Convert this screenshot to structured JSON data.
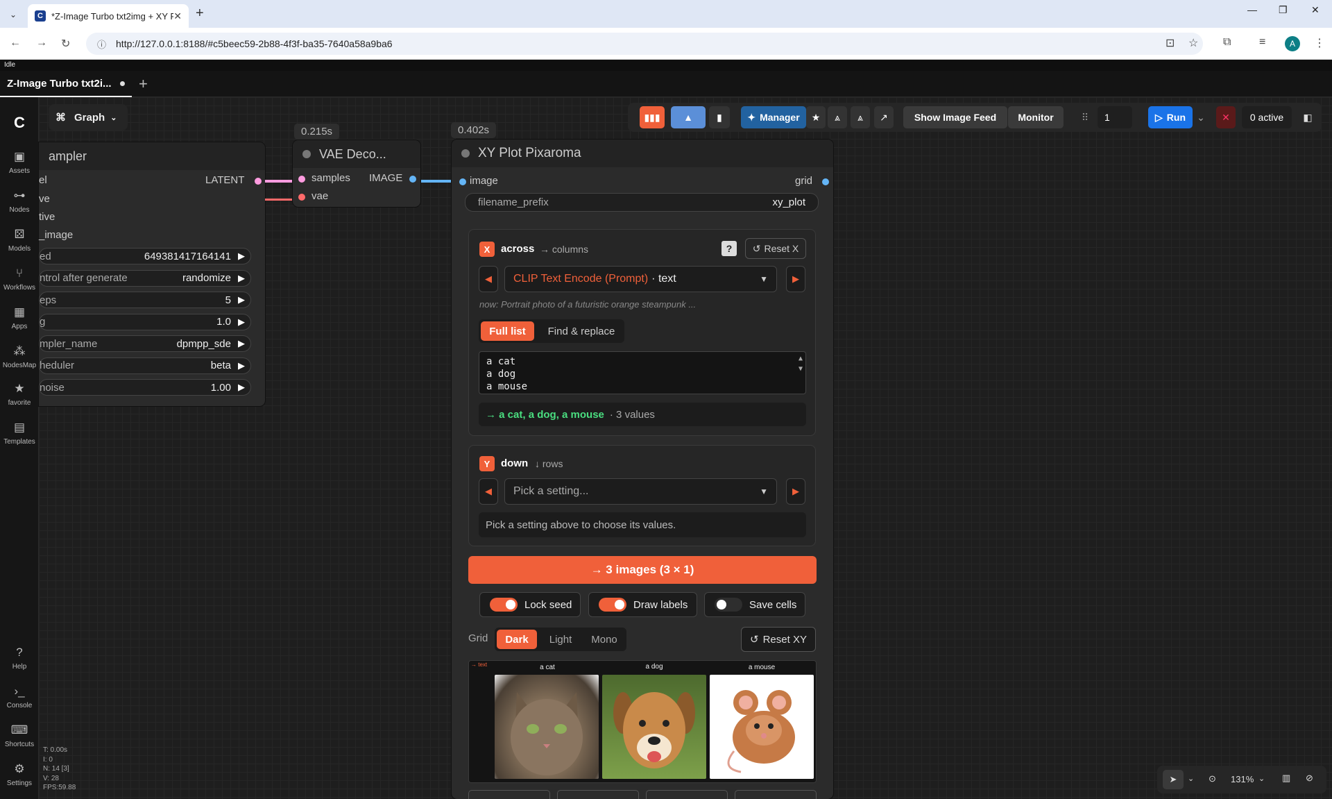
{
  "browser": {
    "tab_title": "*Z-Image Turbo txt2img + XY P",
    "url": "http://127.0.0.1:8188/#c5beec59-2b88-4f3f-ba35-7640a58a9ba6",
    "avatar": "A"
  },
  "status": "Idle",
  "workspace": {
    "tab": "Z-Image Turbo txt2i...",
    "view_button": "Graph"
  },
  "sidebar": [
    {
      "label": "Assets",
      "icon": "image-icon"
    },
    {
      "label": "Nodes",
      "icon": "node-icon"
    },
    {
      "label": "Models",
      "icon": "cube-icon"
    },
    {
      "label": "Workflows",
      "icon": "workflow-icon"
    },
    {
      "label": "Apps",
      "icon": "apps-icon"
    },
    {
      "label": "NodesMap",
      "icon": "map-icon"
    },
    {
      "label": "favorite",
      "icon": "star-icon"
    },
    {
      "label": "Templates",
      "icon": "template-icon"
    },
    {
      "label": "Help",
      "icon": "help-icon"
    },
    {
      "label": "Console",
      "icon": "terminal-icon"
    },
    {
      "label": "Shortcuts",
      "icon": "keyboard-icon"
    },
    {
      "label": "Settings",
      "icon": "gear-icon"
    }
  ],
  "toolbar": {
    "manager": "Manager",
    "show_image_feed": "Show Image Feed",
    "monitor": "Monitor",
    "batch_count": "1",
    "run": "Run",
    "active": "0 active",
    "accent": "#f0603a",
    "run_color": "#1a73e8"
  },
  "ksampler": {
    "title": "ampler",
    "latent": "LATENT",
    "inputs": [
      "el",
      "ve",
      "tive",
      "_image"
    ],
    "widgets": [
      {
        "label": "ed",
        "value": "649381417164141"
      },
      {
        "label": "ntrol after generate",
        "value": "randomize"
      },
      {
        "label": "eps",
        "value": "5"
      },
      {
        "label": "g",
        "value": "1.0"
      },
      {
        "label": "mpler_name",
        "value": "dpmpp_sde"
      },
      {
        "label": "heduler",
        "value": "beta"
      },
      {
        "label": "noise",
        "value": "1.00"
      }
    ]
  },
  "vae": {
    "badge": "0.215s",
    "title": "VAE Deco...",
    "in1": "samples",
    "in2": "vae",
    "out": "IMAGE"
  },
  "xyplot": {
    "badge": "0.402s",
    "title": "XY Plot Pixaroma",
    "in": "image",
    "out": "grid",
    "filename_label": "filename_prefix",
    "filename_value": "xy_plot",
    "x_panel": {
      "letter": "X",
      "name": "across",
      "sub": "columns",
      "help": "?",
      "reset": "Reset X",
      "node": "CLIP Text Encode (Prompt)",
      "field": "· text",
      "now": "now: Portrait photo of a futuristic orange steampunk ...",
      "mode_active": "Full list",
      "mode_other": "Find & replace",
      "values": [
        "a cat",
        "a dog",
        "a mouse"
      ],
      "summary": "→ a cat, a dog, a mouse",
      "count": "· 3 values"
    },
    "y_panel": {
      "letter": "Y",
      "name": "down",
      "sub": "rows",
      "placeholder": "Pick a setting...",
      "hint": "Pick a setting above to choose its values."
    },
    "generate": "→ 3 images (3 × 1)",
    "toggles": [
      {
        "label": "Lock seed",
        "on": true
      },
      {
        "label": "Draw labels",
        "on": true
      },
      {
        "label": "Save cells",
        "on": false
      }
    ],
    "grid_label": "Grid",
    "themes": [
      "Dark",
      "Light",
      "Mono"
    ],
    "reset_xy": "Reset XY",
    "preview_axis": "→ text",
    "preview_labels": [
      "a cat",
      "a dog",
      "a mouse"
    ]
  },
  "stats": [
    "T: 0.00s",
    "I: 0",
    "N: 14 [3]",
    "V: 28",
    "FPS:59.88"
  ],
  "zoom": "131%"
}
